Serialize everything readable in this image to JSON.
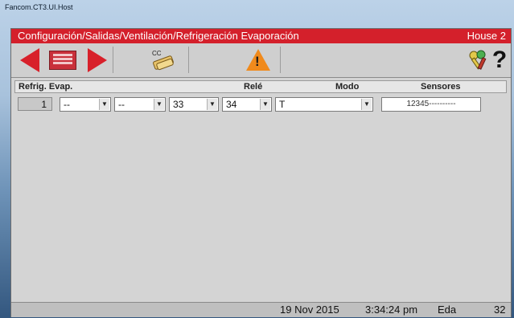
{
  "window": {
    "title": "Fancom.CT3.UI.Host"
  },
  "titlebar": {
    "path": "Configuración/Salidas/Ventilación/Refrigeración Evaporación",
    "house": "House 2"
  },
  "toolbar": {
    "cc_label": "CC",
    "help_label": "?",
    "warning_glyph": "!"
  },
  "table": {
    "headers": {
      "refrig": "Refrig. Evap.",
      "rele": "Relé",
      "modo": "Modo",
      "sensores": "Sensores"
    },
    "row": {
      "index": "1",
      "c1": "--",
      "c2": "--",
      "c3": "33",
      "c4": "34",
      "modo": "T",
      "sensores": "12345----------"
    }
  },
  "status": {
    "date": "19 Nov 2015",
    "time": "3:34:24 pm",
    "user": "Eda",
    "number": "32"
  },
  "colors": {
    "accent": "#d4202b",
    "background": "#d4d4d4",
    "warning": "#f08a1c"
  },
  "icons": [
    "back-arrow-icon",
    "list-icon",
    "forward-arrow-icon",
    "cc-icon",
    "warning-icon",
    "keys-icon",
    "help-icon"
  ]
}
